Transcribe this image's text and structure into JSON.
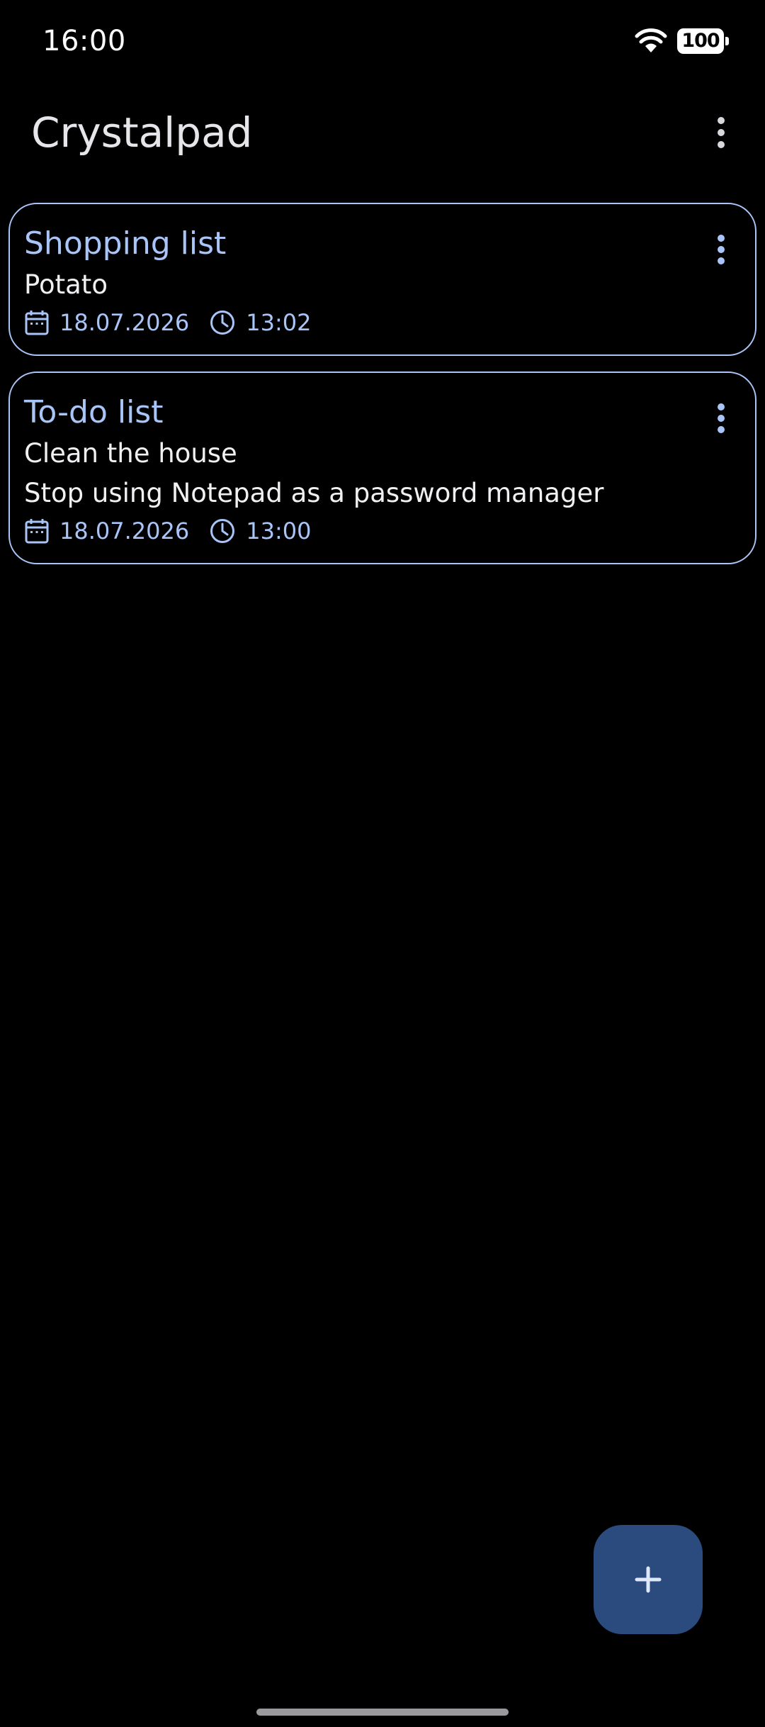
{
  "status_bar": {
    "time": "16:00",
    "battery": "100",
    "icons": [
      "wifi-icon",
      "battery-icon"
    ]
  },
  "app_bar": {
    "title": "Crystalpad",
    "menu_icon": "more-vert-icon"
  },
  "notes": [
    {
      "title": "Shopping list",
      "lines": [
        "Potato"
      ],
      "date": "18.07.2026",
      "time": "13:02"
    },
    {
      "title": "To-do list",
      "lines": [
        "Clean the house",
        "Stop using Notepad as a password manager"
      ],
      "date": "18.07.2026",
      "time": "13:00"
    }
  ],
  "fab": {
    "icon": "plus-icon"
  },
  "colors": {
    "background": "#000000",
    "accent": "#a9c4f7",
    "fab_background": "#2b4a7d",
    "text": "#f0f0f2"
  }
}
